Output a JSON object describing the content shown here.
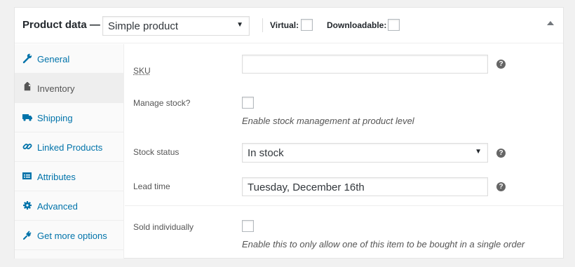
{
  "header": {
    "title": "Product data —",
    "product_type": "Simple product",
    "virtual_label": "Virtual:",
    "downloadable_label": "Downloadable:"
  },
  "sidebar": {
    "items": [
      {
        "label": "General",
        "icon": "wrench-icon",
        "active": false
      },
      {
        "label": "Inventory",
        "icon": "tag-icon",
        "active": true
      },
      {
        "label": "Shipping",
        "icon": "truck-icon",
        "active": false
      },
      {
        "label": "Linked Products",
        "icon": "link-icon",
        "active": false
      },
      {
        "label": "Attributes",
        "icon": "list-icon",
        "active": false
      },
      {
        "label": "Advanced",
        "icon": "gear-icon",
        "active": false
      },
      {
        "label": "Get more options",
        "icon": "plugin-icon",
        "active": false
      }
    ]
  },
  "inventory": {
    "sku_label": "SKU",
    "sku_value": "",
    "manage_stock_label": "Manage stock?",
    "manage_stock_desc": "Enable stock management at product level",
    "stock_status_label": "Stock status",
    "stock_status_value": "In stock",
    "lead_time_label": "Lead time",
    "lead_time_value": "Tuesday, December 16th",
    "sold_individually_label": "Sold individually",
    "sold_individually_desc": "Enable this to only allow one of this item to be bought in a single order",
    "help_glyph": "?"
  },
  "colors": {
    "link": "#0073aa",
    "active_tab_bg": "#eeeeee",
    "sidebar_bg": "#fafafa",
    "help_icon": "#666666"
  }
}
